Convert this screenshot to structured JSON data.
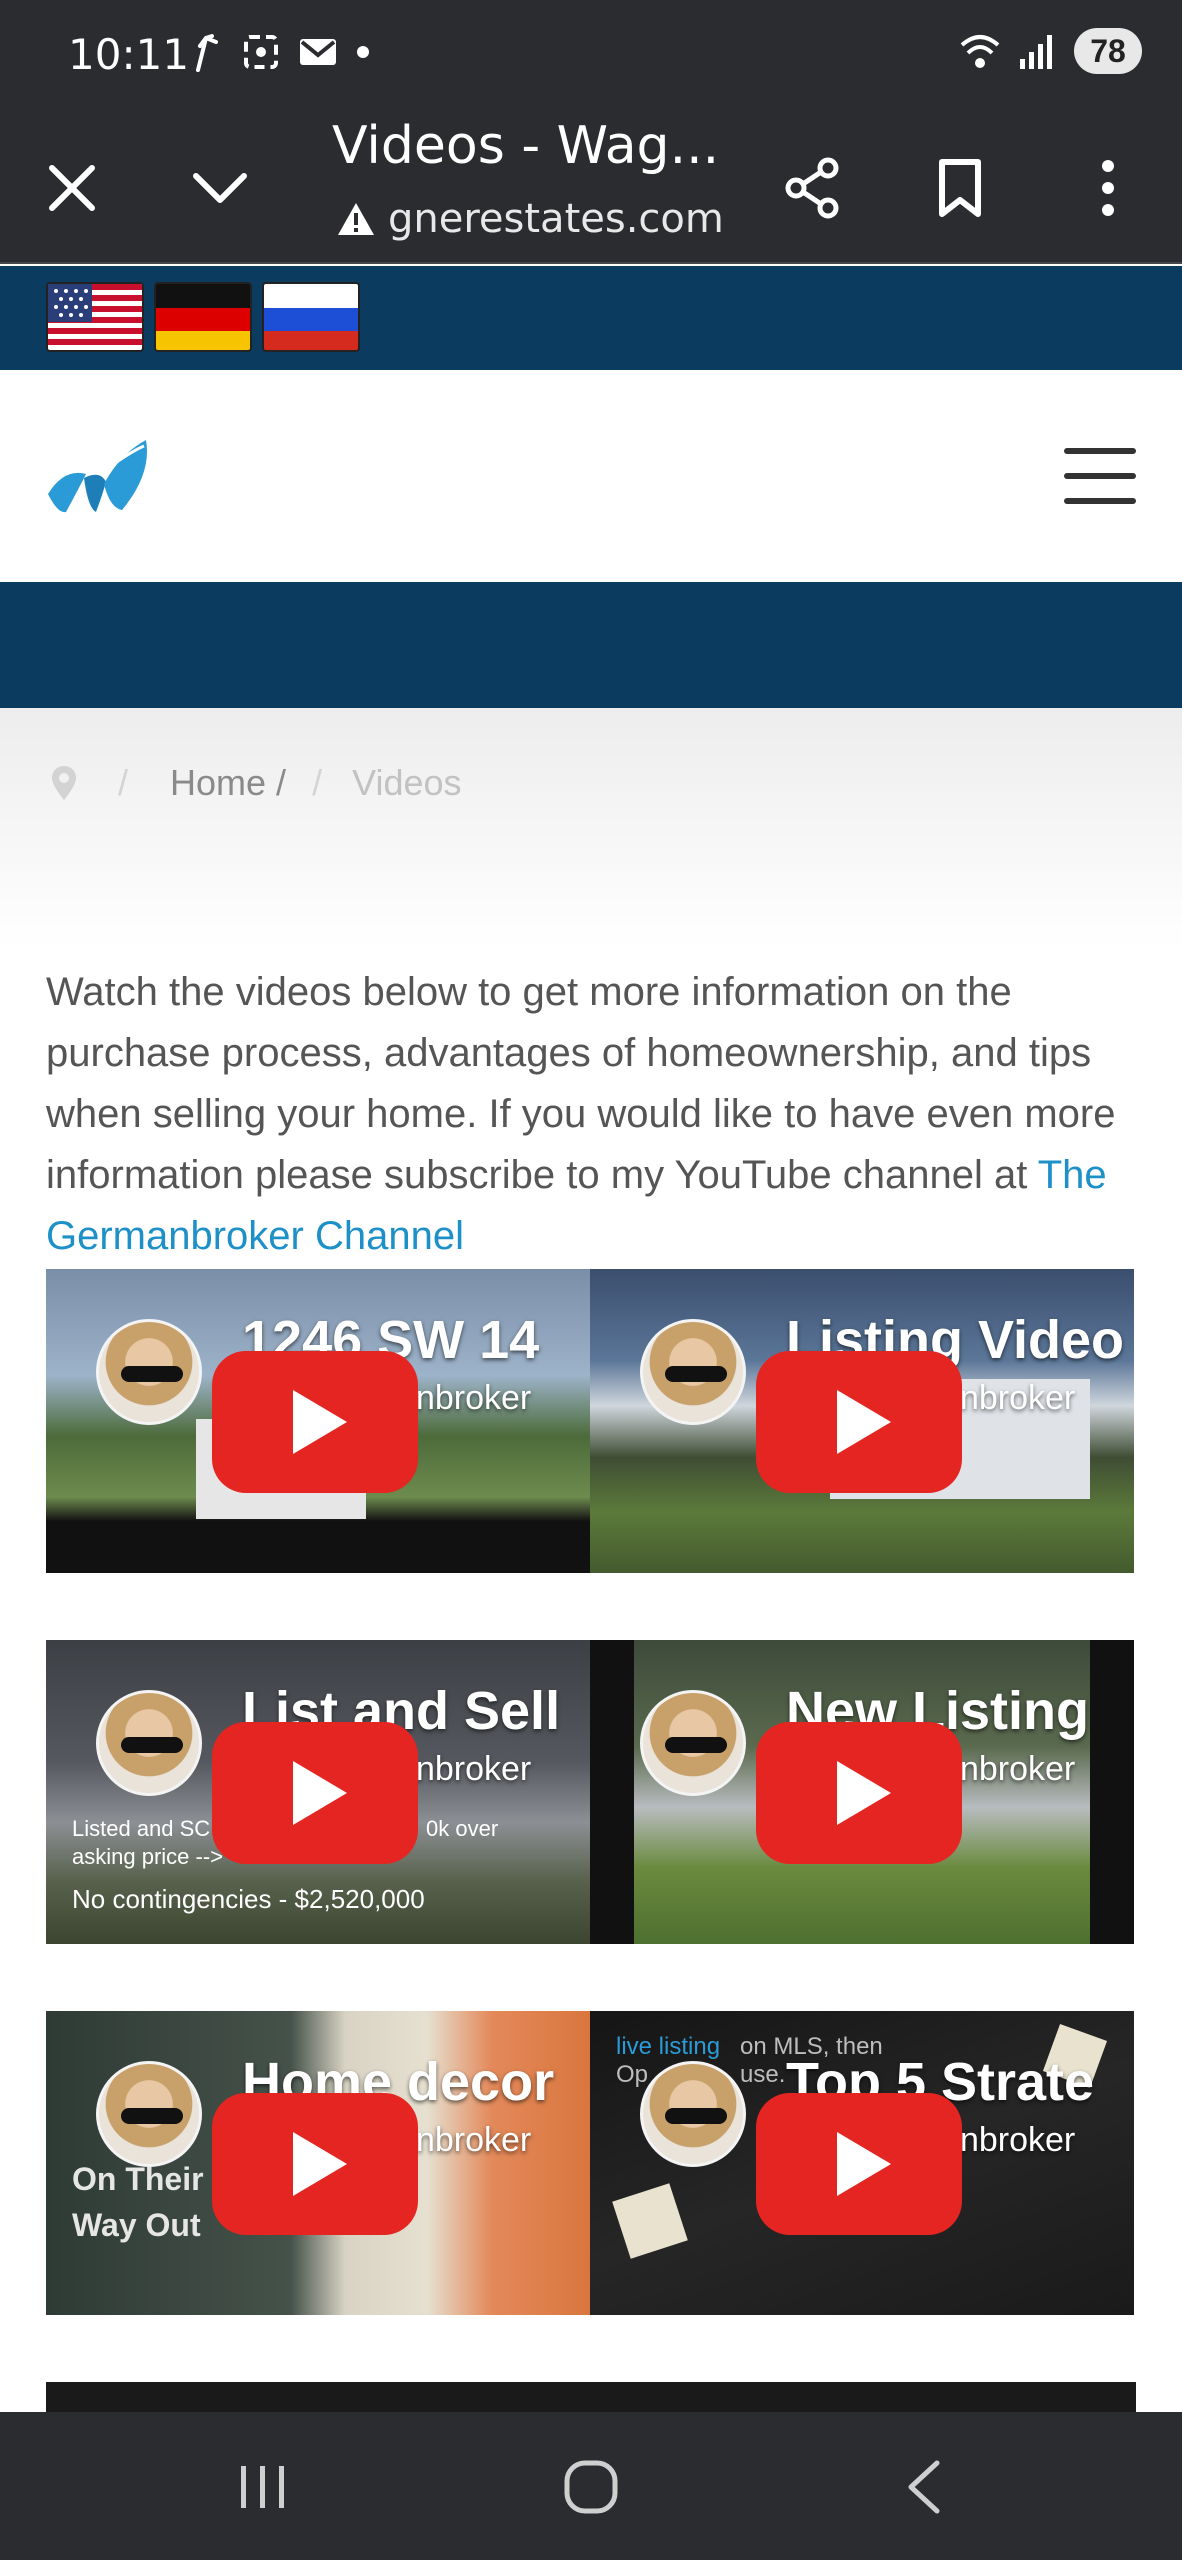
{
  "status_bar": {
    "time": "10:11",
    "battery": "78"
  },
  "browser": {
    "title": "Videos - Wag...",
    "url": "gnerestates.com"
  },
  "flags": [
    "us-flag",
    "germany-flag",
    "russia-flag"
  ],
  "breadcrumb": {
    "home": "Home /",
    "current": "Videos"
  },
  "intro": {
    "text": "Watch the videos below to get more information on the purchase process, advantages of homeownership, and tips when selling your home. If you would like to have even more information please subscribe to my YouTube channel at ",
    "link": "The Germanbroker Channel"
  },
  "videos": [
    {
      "title": "1246 SW 14",
      "channel": "The Germanbroker"
    },
    {
      "title": "Listing Video",
      "channel": "The Germanbroker"
    },
    {
      "title": "List and Sell",
      "channel": "The Germanbroker",
      "overlay_top": "Listed and SC",
      "overlay_mid": "0k over",
      "overlay_mid2": "asking price -->",
      "overlay_bottom": "No contingencies - $2,520,000"
    },
    {
      "title": "New Listing",
      "channel": "The Germanbroker"
    },
    {
      "title": "Home decor",
      "channel": "The Germanbroker",
      "overlay_top": "On Their",
      "overlay_bottom": "Way Out"
    },
    {
      "title": "Top 5 Strate",
      "channel": "The Germanbroker",
      "overlay_top": "live listing",
      "overlay_top2": "on MLS, then",
      "overlay_mid": "Op",
      "overlay_mid2": "use."
    }
  ]
}
